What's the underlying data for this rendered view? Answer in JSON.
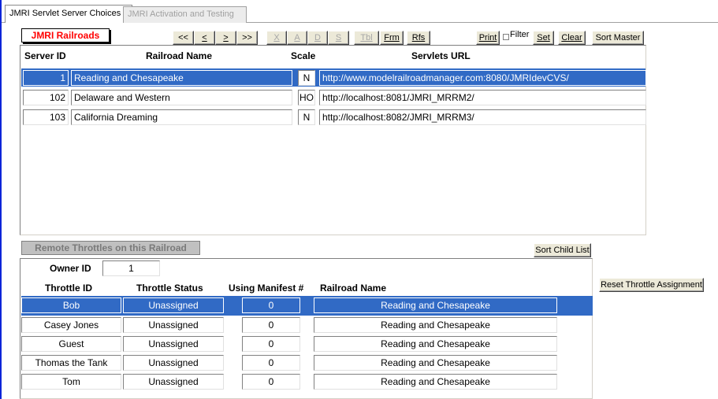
{
  "tabs": [
    {
      "label": "JMRI Servlet Server Choices",
      "active": true
    },
    {
      "label": "JMRI Activation and Testing",
      "active": false
    }
  ],
  "railroads_section": {
    "title": "JMRI Railroads",
    "nav_buttons": [
      {
        "label": "<<",
        "enabled": true
      },
      {
        "label": "<",
        "enabled": true
      },
      {
        "label": ">",
        "enabled": true
      },
      {
        "label": ">>",
        "enabled": true
      },
      {
        "label": "X",
        "enabled": false
      },
      {
        "label": "A",
        "enabled": false
      },
      {
        "label": "D",
        "enabled": false
      },
      {
        "label": "S",
        "enabled": false
      },
      {
        "label": "Tbl",
        "enabled": false
      },
      {
        "label": "Frm",
        "enabled": true
      },
      {
        "label": "Rfs",
        "enabled": true
      }
    ],
    "print_label": "Print",
    "filter_label": "Filter",
    "set_label": "Set",
    "clear_label": "Clear",
    "sort_master_label": "Sort Master",
    "columns": [
      "Server ID",
      "Railroad Name",
      "Scale",
      "Servlets URL"
    ],
    "rows": [
      {
        "id": "1",
        "name": "Reading and Chesapeake",
        "scale": "N",
        "url": "http://www.modelrailroadmanager.com:8080/JMRIdevCVS/",
        "selected": true
      },
      {
        "id": "102",
        "name": "Delaware and Western",
        "scale": "HO",
        "url": "http://localhost:8081/JMRI_MRRM2/",
        "selected": false
      },
      {
        "id": "103",
        "name": "California Dreaming",
        "scale": "N",
        "url": "http://localhost:8082/JMRI_MRRM3/",
        "selected": false
      }
    ]
  },
  "throttles_section": {
    "title": "Remote Throttles on this Railroad",
    "sort_child_label": "Sort Child List",
    "reset_label": "Reset Throttle Assignment",
    "owner_label": "Owner ID",
    "owner_value": "1",
    "columns": [
      "Throttle ID",
      "Throttle Status",
      "Using Manifest #",
      "Railroad Name"
    ],
    "rows": [
      {
        "throttle": "Bob",
        "status": "Unassigned",
        "manifest": "0",
        "railroad": "Reading and Chesapeake",
        "selected": true
      },
      {
        "throttle": "Casey Jones",
        "status": "Unassigned",
        "manifest": "0",
        "railroad": "Reading and Chesapeake",
        "selected": false
      },
      {
        "throttle": "Guest",
        "status": "Unassigned",
        "manifest": "0",
        "railroad": "Reading and Chesapeake",
        "selected": false
      },
      {
        "throttle": "Thomas the Tank",
        "status": "Unassigned",
        "manifest": "0",
        "railroad": "Reading and Chesapeake",
        "selected": false
      },
      {
        "throttle": "Tom",
        "status": "Unassigned",
        "manifest": "0",
        "railroad": "Reading and Chesapeake",
        "selected": false
      }
    ]
  },
  "colors": {
    "selection": "#316ac5",
    "title_red": "#ff0000",
    "disabled_text": "#a7a7a7",
    "window_blue": "#0a24d8"
  }
}
